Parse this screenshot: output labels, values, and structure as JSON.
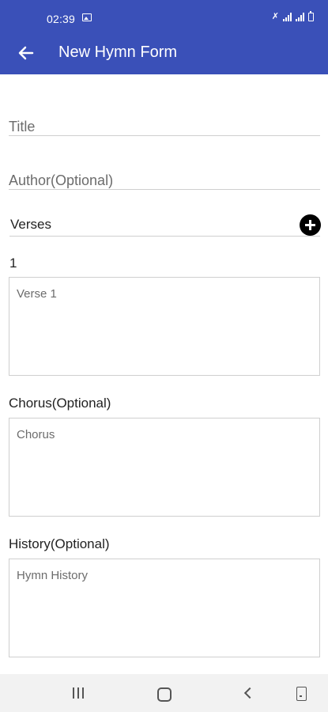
{
  "status_bar": {
    "time": "02:39",
    "icons": [
      "image-icon",
      "mute-icon",
      "signal-icon",
      "signal-icon",
      "battery-icon"
    ]
  },
  "app_bar": {
    "title": "New Hymn Form",
    "back_icon": "arrow-left-icon",
    "color": "#3a50b8"
  },
  "form": {
    "title_placeholder": "Title",
    "author_placeholder": "Author(Optional)",
    "verses_label": "Verses",
    "add_icon": "plus-circle-icon",
    "verses": [
      {
        "number": "1",
        "placeholder": "Verse 1"
      }
    ],
    "chorus_label": "Chorus(Optional)",
    "chorus_placeholder": "Chorus",
    "history_label": "History(Optional)",
    "history_placeholder": "Hymn History"
  },
  "nav_bar": {
    "buttons": [
      "recent-apps-icon",
      "home-icon",
      "back-icon",
      "keyboard-toggle-icon"
    ]
  }
}
